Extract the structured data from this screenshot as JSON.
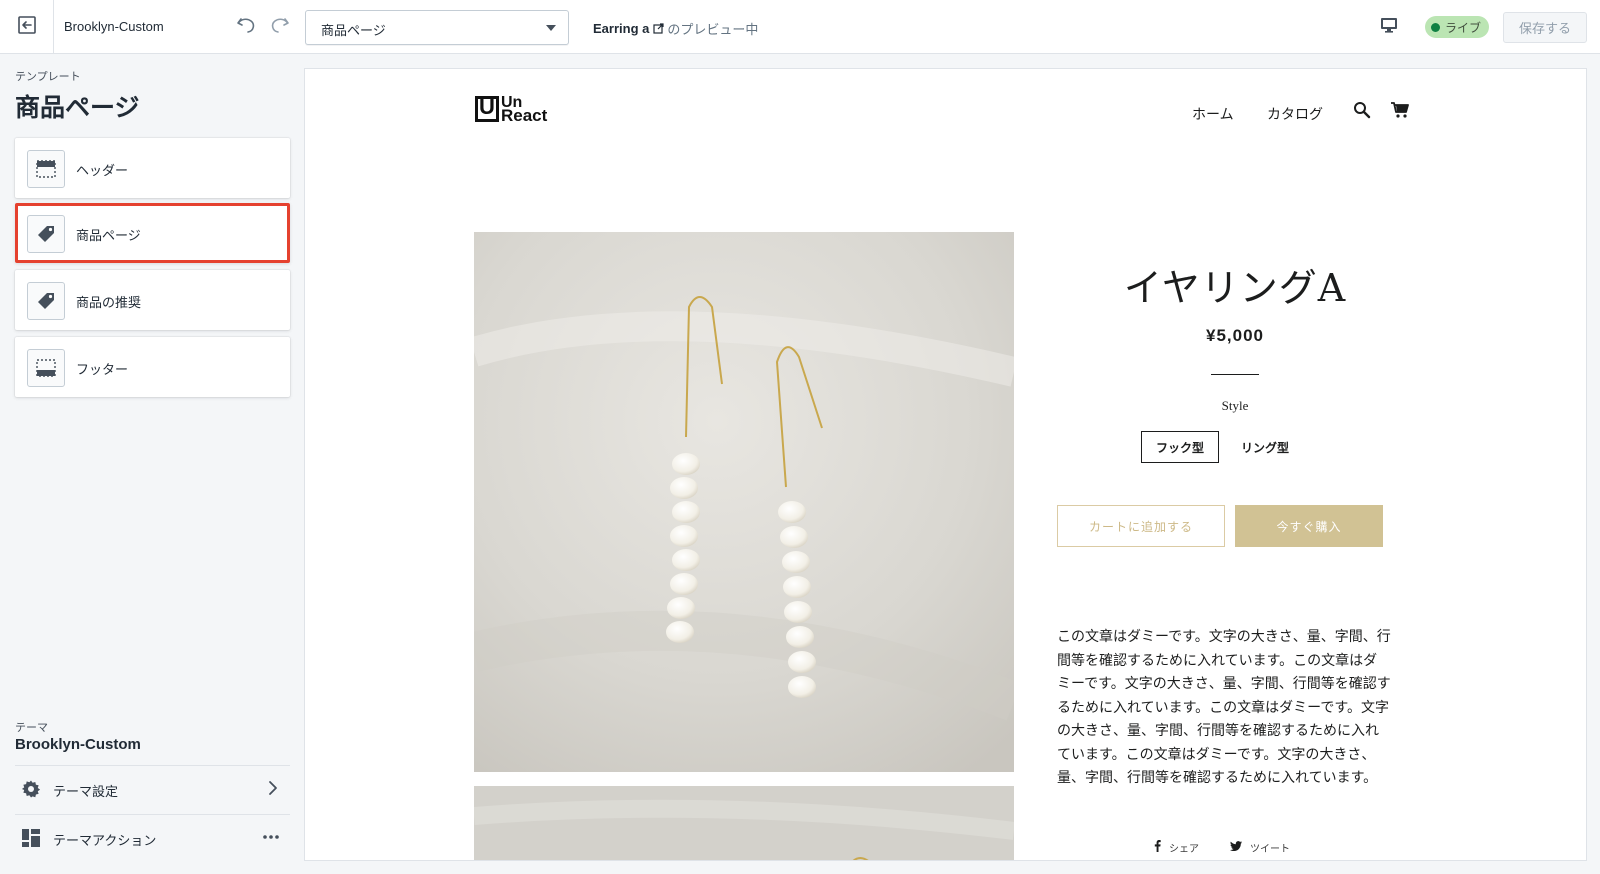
{
  "topbar": {
    "theme_name": "Brooklyn-Custom",
    "page_select": "商品ページ",
    "preview_product": "Earring a",
    "preview_suffix": "のプレビュー中",
    "live_label": "ライブ",
    "save_label": "保存する"
  },
  "sidebar": {
    "template_caption": "テンプレート",
    "template_title": "商品ページ",
    "sections": [
      {
        "label": "ヘッダー",
        "icon": "header-layout-icon"
      },
      {
        "label": "商品ページ",
        "icon": "tag-icon",
        "selected": true
      },
      {
        "label": "商品の推奨",
        "icon": "tag-icon"
      },
      {
        "label": "フッター",
        "icon": "footer-layout-icon"
      }
    ],
    "theme_caption": "テーマ",
    "theme_name": "Brooklyn-Custom",
    "theme_settings": "テーマ設定",
    "theme_actions": "テーマアクション"
  },
  "preview": {
    "logo_l1": "Un",
    "logo_l2": "React",
    "logo_box": "U",
    "nav_home": "ホーム",
    "nav_catalog": "カタログ",
    "product_title": "イヤリングA",
    "price": "¥5,000",
    "option_label": "Style",
    "variants": [
      "フック型",
      "リング型"
    ],
    "add_to_cart": "カートに追加する",
    "buy_now": "今すぐ購入",
    "description": "この文章はダミーです。文字の大きさ、量、字間、行間等を確認するために入れています。この文章はダミーです。文字の大きさ、量、字間、行間等を確認するために入れています。この文章はダミーです。文字の大きさ、量、字間、行間等を確認するために入れています。この文章はダミーです。文字の大きさ、量、字間、行間等を確認するために入れています。",
    "share_label": "シェア",
    "tweet_label": "ツイート"
  },
  "colors": {
    "accent_selected": "#e5412f",
    "live_badge": "#bbe5b3",
    "buy_button": "#d1c294",
    "cart_border": "#dbcba4"
  }
}
